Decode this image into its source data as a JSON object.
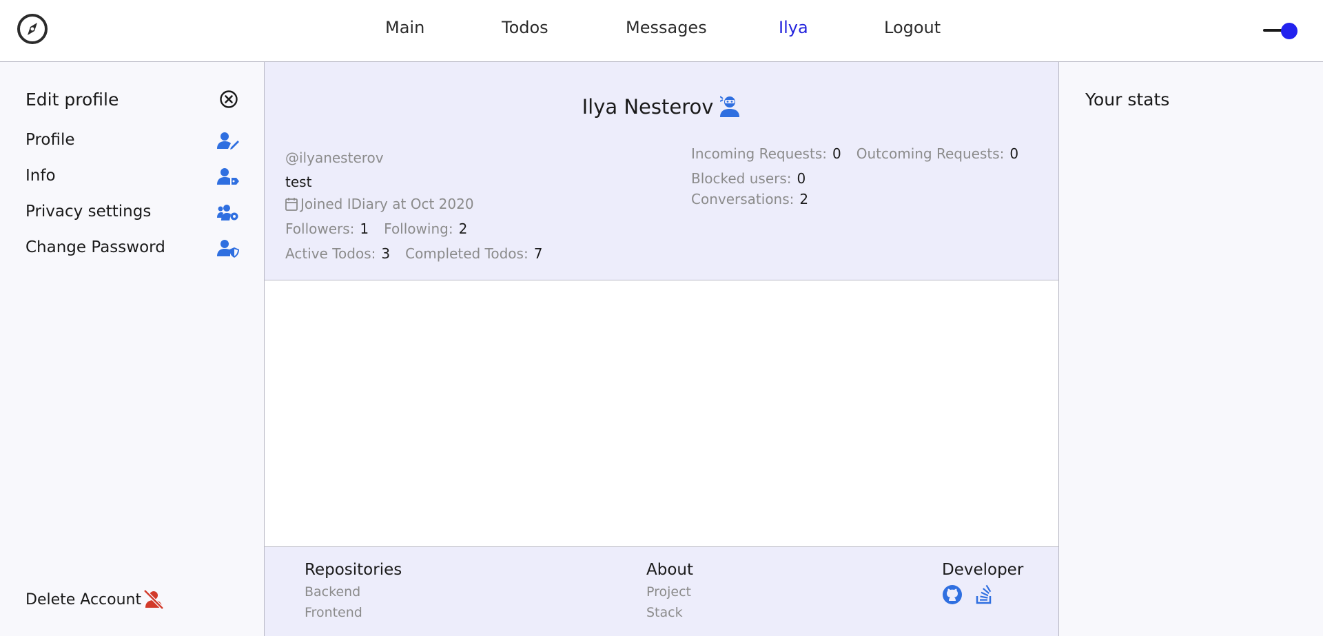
{
  "header": {
    "nav": [
      {
        "label": "Main"
      },
      {
        "label": "Todos"
      },
      {
        "label": "Messages"
      },
      {
        "label": "Ilya"
      },
      {
        "label": "Logout"
      }
    ],
    "active_index": 3,
    "theme_toggle_on": true
  },
  "sidebar": {
    "title": "Edit profile",
    "items": [
      {
        "label": "Profile",
        "icon": "user-edit-icon"
      },
      {
        "label": "Info",
        "icon": "user-tag-icon"
      },
      {
        "label": "Privacy settings",
        "icon": "users-cog-icon"
      },
      {
        "label": "Change Password",
        "icon": "user-shield-icon"
      }
    ],
    "delete_label": "Delete Account"
  },
  "profile": {
    "name": "Ilya Nesterov",
    "username": "@ilyanesterov",
    "bio": "test",
    "joined": "Joined IDiary at Oct 2020",
    "followers_label": "Followers:",
    "followers": "1",
    "following_label": "Following:",
    "following": "2",
    "active_todos_label": "Active Todos:",
    "active_todos": "3",
    "completed_todos_label": "Completed Todos:",
    "completed_todos": "7",
    "incoming_label": "Incoming Requests:",
    "incoming": "0",
    "outcoming_label": "Outcoming Requests:",
    "outcoming": "0",
    "blocked_label": "Blocked users:",
    "blocked": "0",
    "conversations_label": "Conversations:",
    "conversations": "2"
  },
  "footer": {
    "repositories": {
      "title": "Repositories",
      "links": [
        "Backend",
        "Frontend"
      ]
    },
    "about": {
      "title": "About",
      "links": [
        "Project",
        "Stack"
      ]
    },
    "developer": {
      "title": "Developer",
      "icons": [
        "github-icon",
        "stackoverflow-icon"
      ]
    }
  },
  "right_sidebar": {
    "title": "Your stats"
  },
  "colors": {
    "accent_blue": "#2f6fe0",
    "active_nav": "#2222dd",
    "danger_red": "#d23a2a",
    "card_bg": "#ededfb"
  }
}
